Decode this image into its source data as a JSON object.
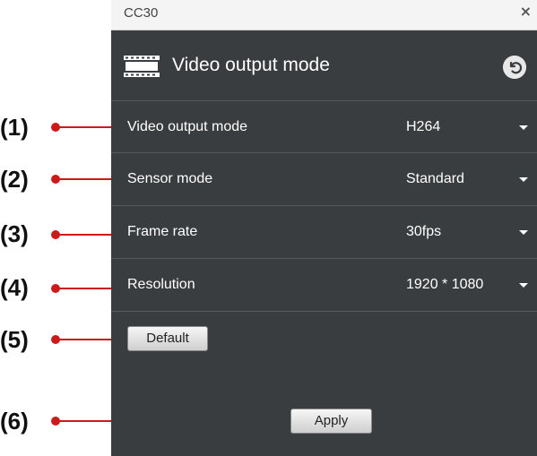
{
  "annotations": [
    "(1)",
    "(2)",
    "(3)",
    "(4)",
    "(5)",
    "(6)"
  ],
  "window": {
    "title": "CC30",
    "close_glyph": "×"
  },
  "header": {
    "title": "Video output mode",
    "icon": "film-strip-icon",
    "back_icon": "back-arrow-icon"
  },
  "rows": [
    {
      "label": "Video output mode",
      "value": "H264"
    },
    {
      "label": "Sensor mode",
      "value": "Standard"
    },
    {
      "label": "Frame rate",
      "value": "30fps"
    },
    {
      "label": "Resolution",
      "value": "1920 * 1080"
    }
  ],
  "buttons": {
    "default_label": "Default",
    "apply_label": "Apply"
  },
  "colors": {
    "panel": "#3a3d3f",
    "annotation": "#cc1a1a",
    "titlebar": "#f4f4f4"
  }
}
